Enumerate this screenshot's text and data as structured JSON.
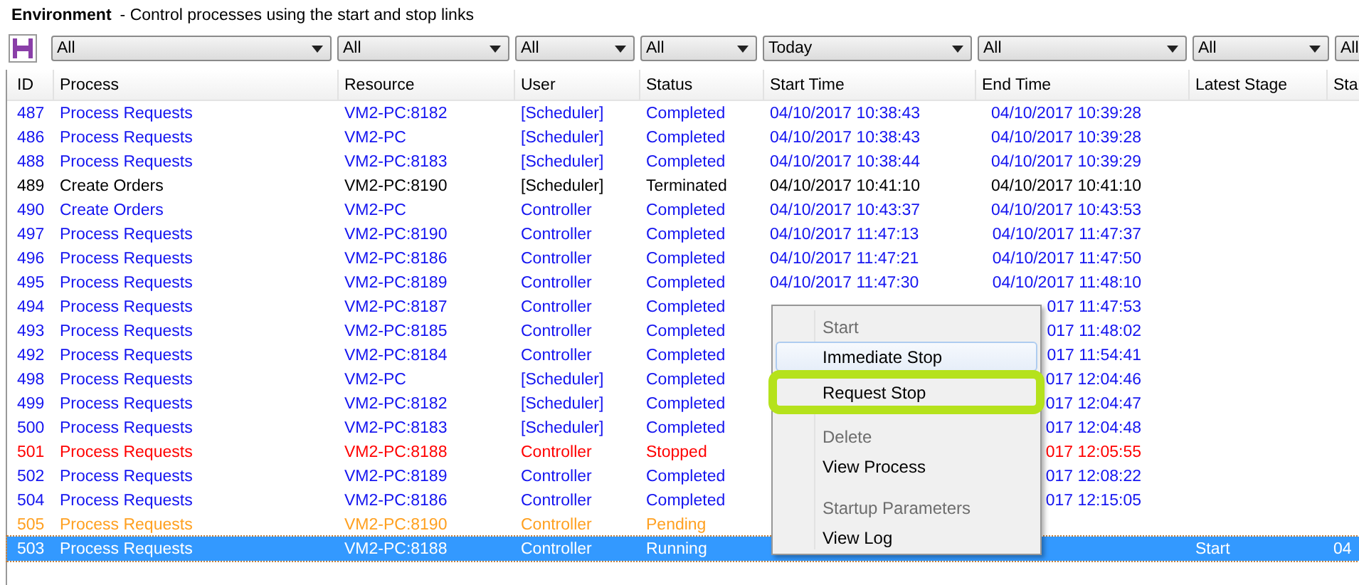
{
  "header": {
    "title": "Environment",
    "description": "- Control processes using the start and stop links"
  },
  "filters": [
    "All",
    "All",
    "All",
    "All",
    "Today",
    "All",
    "All",
    "All"
  ],
  "table": {
    "columns": [
      "ID",
      "Process",
      "Resource",
      "User",
      "Status",
      "Start Time",
      "End Time",
      "Latest Stage",
      "Sta"
    ],
    "rows": [
      {
        "id": "487",
        "process": "Process Requests",
        "resource": "VM2-PC:8182",
        "user": "[Scheduler]",
        "status": "Completed",
        "start_time": "04/10/2017 10:38:43",
        "end_time": "04/10/2017 10:39:28",
        "color": "#1414f0",
        "selected": false
      },
      {
        "id": "486",
        "process": "Process Requests",
        "resource": "VM2-PC",
        "user": "[Scheduler]",
        "status": "Completed",
        "start_time": "04/10/2017 10:38:43",
        "end_time": "04/10/2017 10:39:28",
        "color": "#1414f0",
        "selected": false
      },
      {
        "id": "488",
        "process": "Process Requests",
        "resource": "VM2-PC:8183",
        "user": "[Scheduler]",
        "status": "Completed",
        "start_time": "04/10/2017 10:38:44",
        "end_time": "04/10/2017 10:39:29",
        "color": "#1414f0",
        "selected": false
      },
      {
        "id": "489",
        "process": "Create Orders",
        "resource": "VM2-PC:8190",
        "user": "[Scheduler]",
        "status": "Terminated",
        "start_time": "04/10/2017 10:41:10",
        "end_time": "04/10/2017 10:41:10",
        "color": "#000000",
        "selected": false
      },
      {
        "id": "490",
        "process": "Create Orders",
        "resource": "VM2-PC",
        "user": "Controller",
        "status": "Completed",
        "start_time": "04/10/2017 10:43:37",
        "end_time": "04/10/2017 10:43:53",
        "color": "#1414f0",
        "selected": false
      },
      {
        "id": "497",
        "process": "Process Requests",
        "resource": "VM2-PC:8190",
        "user": "Controller",
        "status": "Completed",
        "start_time": "04/10/2017 11:47:13",
        "end_time": "04/10/2017 11:47:37",
        "color": "#1414f0",
        "selected": false
      },
      {
        "id": "496",
        "process": "Process Requests",
        "resource": "VM2-PC:8186",
        "user": "Controller",
        "status": "Completed",
        "start_time": "04/10/2017 11:47:21",
        "end_time": "04/10/2017 11:47:50",
        "color": "#1414f0",
        "selected": false
      },
      {
        "id": "495",
        "process": "Process Requests",
        "resource": "VM2-PC:8189",
        "user": "Controller",
        "status": "Completed",
        "start_time": "04/10/2017 11:47:30",
        "end_time": "04/10/2017 11:48:10",
        "color": "#1414f0",
        "selected": false
      },
      {
        "id": "494",
        "process": "Process Requests",
        "resource": "VM2-PC:8187",
        "user": "Controller",
        "status": "Completed",
        "end_time": "017 11:47:53",
        "color": "#1414f0",
        "selected": false
      },
      {
        "id": "493",
        "process": "Process Requests",
        "resource": "VM2-PC:8185",
        "user": "Controller",
        "status": "Completed",
        "end_time": "017 11:48:02",
        "color": "#1414f0",
        "selected": false
      },
      {
        "id": "492",
        "process": "Process Requests",
        "resource": "VM2-PC:8184",
        "user": "Controller",
        "status": "Completed",
        "end_time": "017 11:54:41",
        "color": "#1414f0",
        "selected": false
      },
      {
        "id": "498",
        "process": "Process Requests",
        "resource": "VM2-PC",
        "user": "[Scheduler]",
        "status": "Completed",
        "end_time": "017 12:04:46",
        "color": "#1414f0",
        "selected": false
      },
      {
        "id": "499",
        "process": "Process Requests",
        "resource": "VM2-PC:8182",
        "user": "[Scheduler]",
        "status": "Completed",
        "end_time": "017 12:04:47",
        "color": "#1414f0",
        "selected": false
      },
      {
        "id": "500",
        "process": "Process Requests",
        "resource": "VM2-PC:8183",
        "user": "[Scheduler]",
        "status": "Completed",
        "end_time": "017 12:04:48",
        "color": "#1414f0",
        "selected": false
      },
      {
        "id": "501",
        "process": "Process Requests",
        "resource": "VM2-PC:8188",
        "user": "Controller",
        "status": "Stopped",
        "end_time": "017 12:05:55",
        "color": "#ff0000",
        "selected": false
      },
      {
        "id": "502",
        "process": "Process Requests",
        "resource": "VM2-PC:8189",
        "user": "Controller",
        "status": "Completed",
        "end_time": "017 12:08:22",
        "color": "#1414f0",
        "selected": false
      },
      {
        "id": "504",
        "process": "Process Requests",
        "resource": "VM2-PC:8186",
        "user": "Controller",
        "status": "Completed",
        "end_time": "017 12:15:05",
        "color": "#1414f0",
        "selected": false
      },
      {
        "id": "505",
        "process": "Process Requests",
        "resource": "VM2-PC:8190",
        "user": "Controller",
        "status": "Pending",
        "color": "#ffa020",
        "selected": false
      },
      {
        "id": "503",
        "process": "Process Requests",
        "resource": "VM2-PC:8188",
        "user": "Controller",
        "status": "Running",
        "latest_stage": "Start",
        "column_9": "04",
        "selected": true
      }
    ]
  },
  "context_menu": {
    "items": [
      {
        "kind": "item",
        "label": "Start",
        "disabled": true,
        "hovered": false,
        "annotated": false
      },
      {
        "kind": "item",
        "label": "Immediate Stop",
        "disabled": false,
        "hovered": true,
        "annotated": false
      },
      {
        "kind": "item",
        "label": "Request Stop",
        "disabled": false,
        "hovered": false,
        "annotated": true
      },
      {
        "kind": "separator"
      },
      {
        "kind": "item",
        "label": "Delete",
        "disabled": true,
        "hovered": false,
        "annotated": false
      },
      {
        "kind": "item",
        "label": "View Process",
        "disabled": false,
        "hovered": false,
        "annotated": false
      },
      {
        "kind": "separator"
      },
      {
        "kind": "item",
        "label": "Startup Parameters",
        "disabled": true,
        "hovered": false,
        "annotated": false
      },
      {
        "kind": "item",
        "label": "View Log",
        "disabled": false,
        "hovered": false,
        "annotated": false
      }
    ]
  }
}
